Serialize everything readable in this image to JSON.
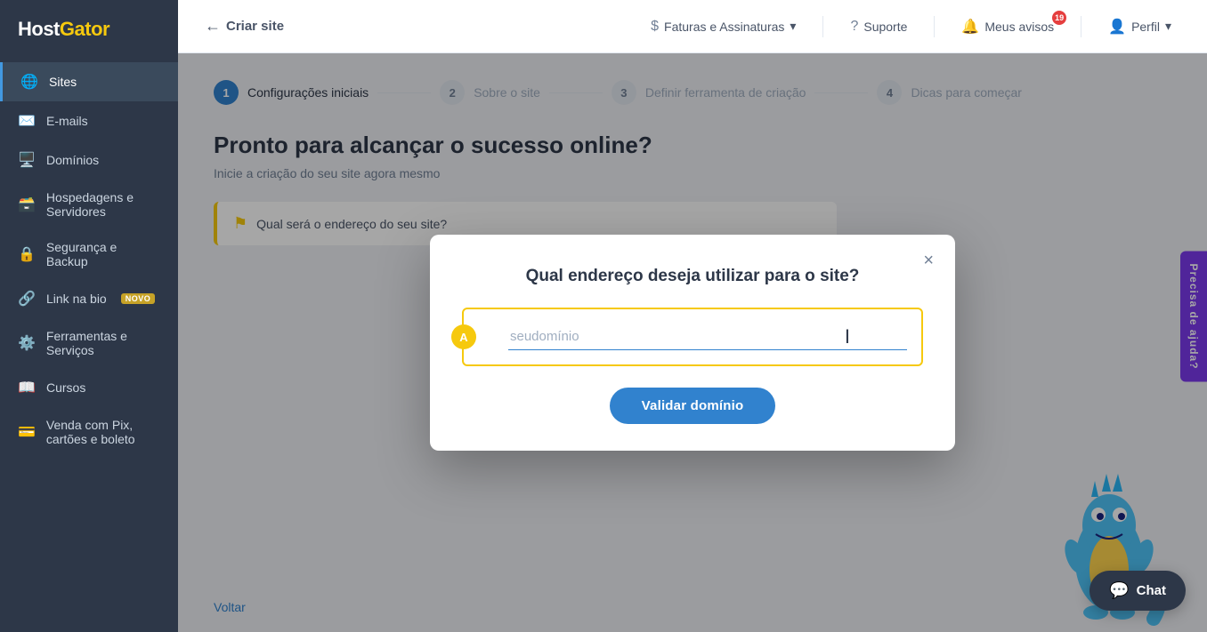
{
  "sidebar": {
    "logo": "HostGator",
    "items": [
      {
        "id": "sites",
        "label": "Sites",
        "icon": "🌐",
        "active": true,
        "badge": null
      },
      {
        "id": "emails",
        "label": "E-mails",
        "icon": "✉️",
        "active": false,
        "badge": null
      },
      {
        "id": "domains",
        "label": "Domínios",
        "icon": "🖥️",
        "active": false,
        "badge": null
      },
      {
        "id": "hosting",
        "label": "Hospedagens e Servidores",
        "icon": "🗃️",
        "active": false,
        "badge": null
      },
      {
        "id": "security",
        "label": "Segurança e Backup",
        "icon": "🔒",
        "active": false,
        "badge": null
      },
      {
        "id": "linkbio",
        "label": "Link na bio",
        "icon": "🔗",
        "active": false,
        "badge": "NOVO"
      },
      {
        "id": "tools",
        "label": "Ferramentas e Serviços",
        "icon": "⚙️",
        "active": false,
        "badge": null
      },
      {
        "id": "courses",
        "label": "Cursos",
        "icon": "📖",
        "active": false,
        "badge": null
      },
      {
        "id": "pix",
        "label": "Venda com Pix, cartões e boleto",
        "icon": "💳",
        "active": false,
        "badge": null
      }
    ]
  },
  "topnav": {
    "back_label": "Criar site",
    "billing_label": "Faturas e Assinaturas",
    "support_label": "Suporte",
    "notifications_label": "Meus avisos",
    "notifications_count": "19",
    "profile_label": "Perfil"
  },
  "stepper": {
    "steps": [
      {
        "num": "1",
        "label": "Configurações iniciais",
        "active": true
      },
      {
        "num": "2",
        "label": "Sobre o site",
        "active": false
      },
      {
        "num": "3",
        "label": "Definir ferramenta de criação",
        "active": false
      },
      {
        "num": "4",
        "label": "Dicas para começar",
        "active": false
      }
    ]
  },
  "page": {
    "title": "Pronto para alcançar o sucesso online?",
    "subtitle": "Inicie a criação do seu site agora mesmo",
    "warning_text": "Qual será o endereço do seu site?",
    "back_link": "Voltar"
  },
  "modal": {
    "title": "Qual endereço deseja utilizar para o site?",
    "domain_placeholder": "seudomínio",
    "step_badge": "A",
    "validate_button": "Validar domínio",
    "close_label": "×"
  },
  "chat": {
    "label": "Chat"
  },
  "right_panel": {
    "label": "Precisa de ajuda?"
  }
}
